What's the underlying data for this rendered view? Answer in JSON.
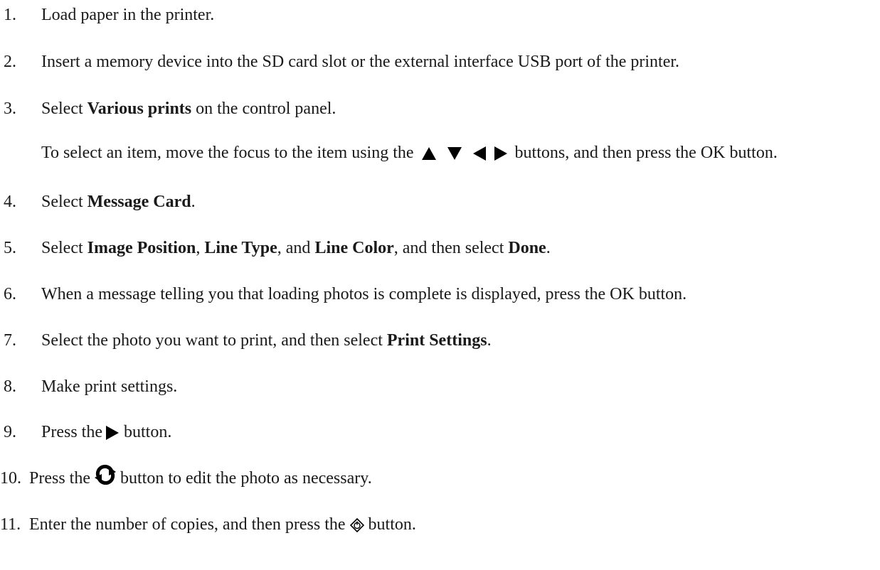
{
  "steps": [
    {
      "num": "1.",
      "text": "Load paper in the printer."
    },
    {
      "num": "2.",
      "text": "Insert a memory device into the SD card slot or the external interface USB port of the printer."
    },
    {
      "num": "3.",
      "pre": "Select ",
      "b1": "Various prints",
      "post": " on the control panel.",
      "note_pre": "To select an item, move the focus to the item using the",
      "note_post": "buttons, and then press the OK button."
    },
    {
      "num": "4.",
      "pre": "Select ",
      "b1": "Message Card",
      "post": "."
    },
    {
      "num": "5.",
      "pre": "Select ",
      "b1": "Image Position",
      "s1": ", ",
      "b2": "Line Type",
      "s2": ", and ",
      "b3": "Line Color",
      "s3": ", and then select ",
      "b4": "Done",
      "post": "."
    },
    {
      "num": "6.",
      "text": "When a message telling you that loading photos is complete is displayed, press the OK button."
    },
    {
      "num": "7.",
      "pre": "Select the photo you want to print, and then select ",
      "b1": "Print Settings",
      "post": "."
    },
    {
      "num": "8.",
      "text": "Make print settings."
    },
    {
      "num": "9.",
      "pre": "Press the",
      "post": "button."
    },
    {
      "num": "10.",
      "pre": "Press the",
      "post": "button to edit the photo as necessary."
    },
    {
      "num": "11.",
      "pre": "Enter the number of copies, and then press the",
      "post": "button."
    }
  ],
  "icons": {
    "nav": [
      "up-arrow-icon",
      "down-arrow-icon",
      "left-arrow-icon",
      "right-arrow-icon"
    ],
    "step9": "right-arrow-icon",
    "step10": "rotate-arrows-icon",
    "step11": "start-diamond-icon"
  }
}
